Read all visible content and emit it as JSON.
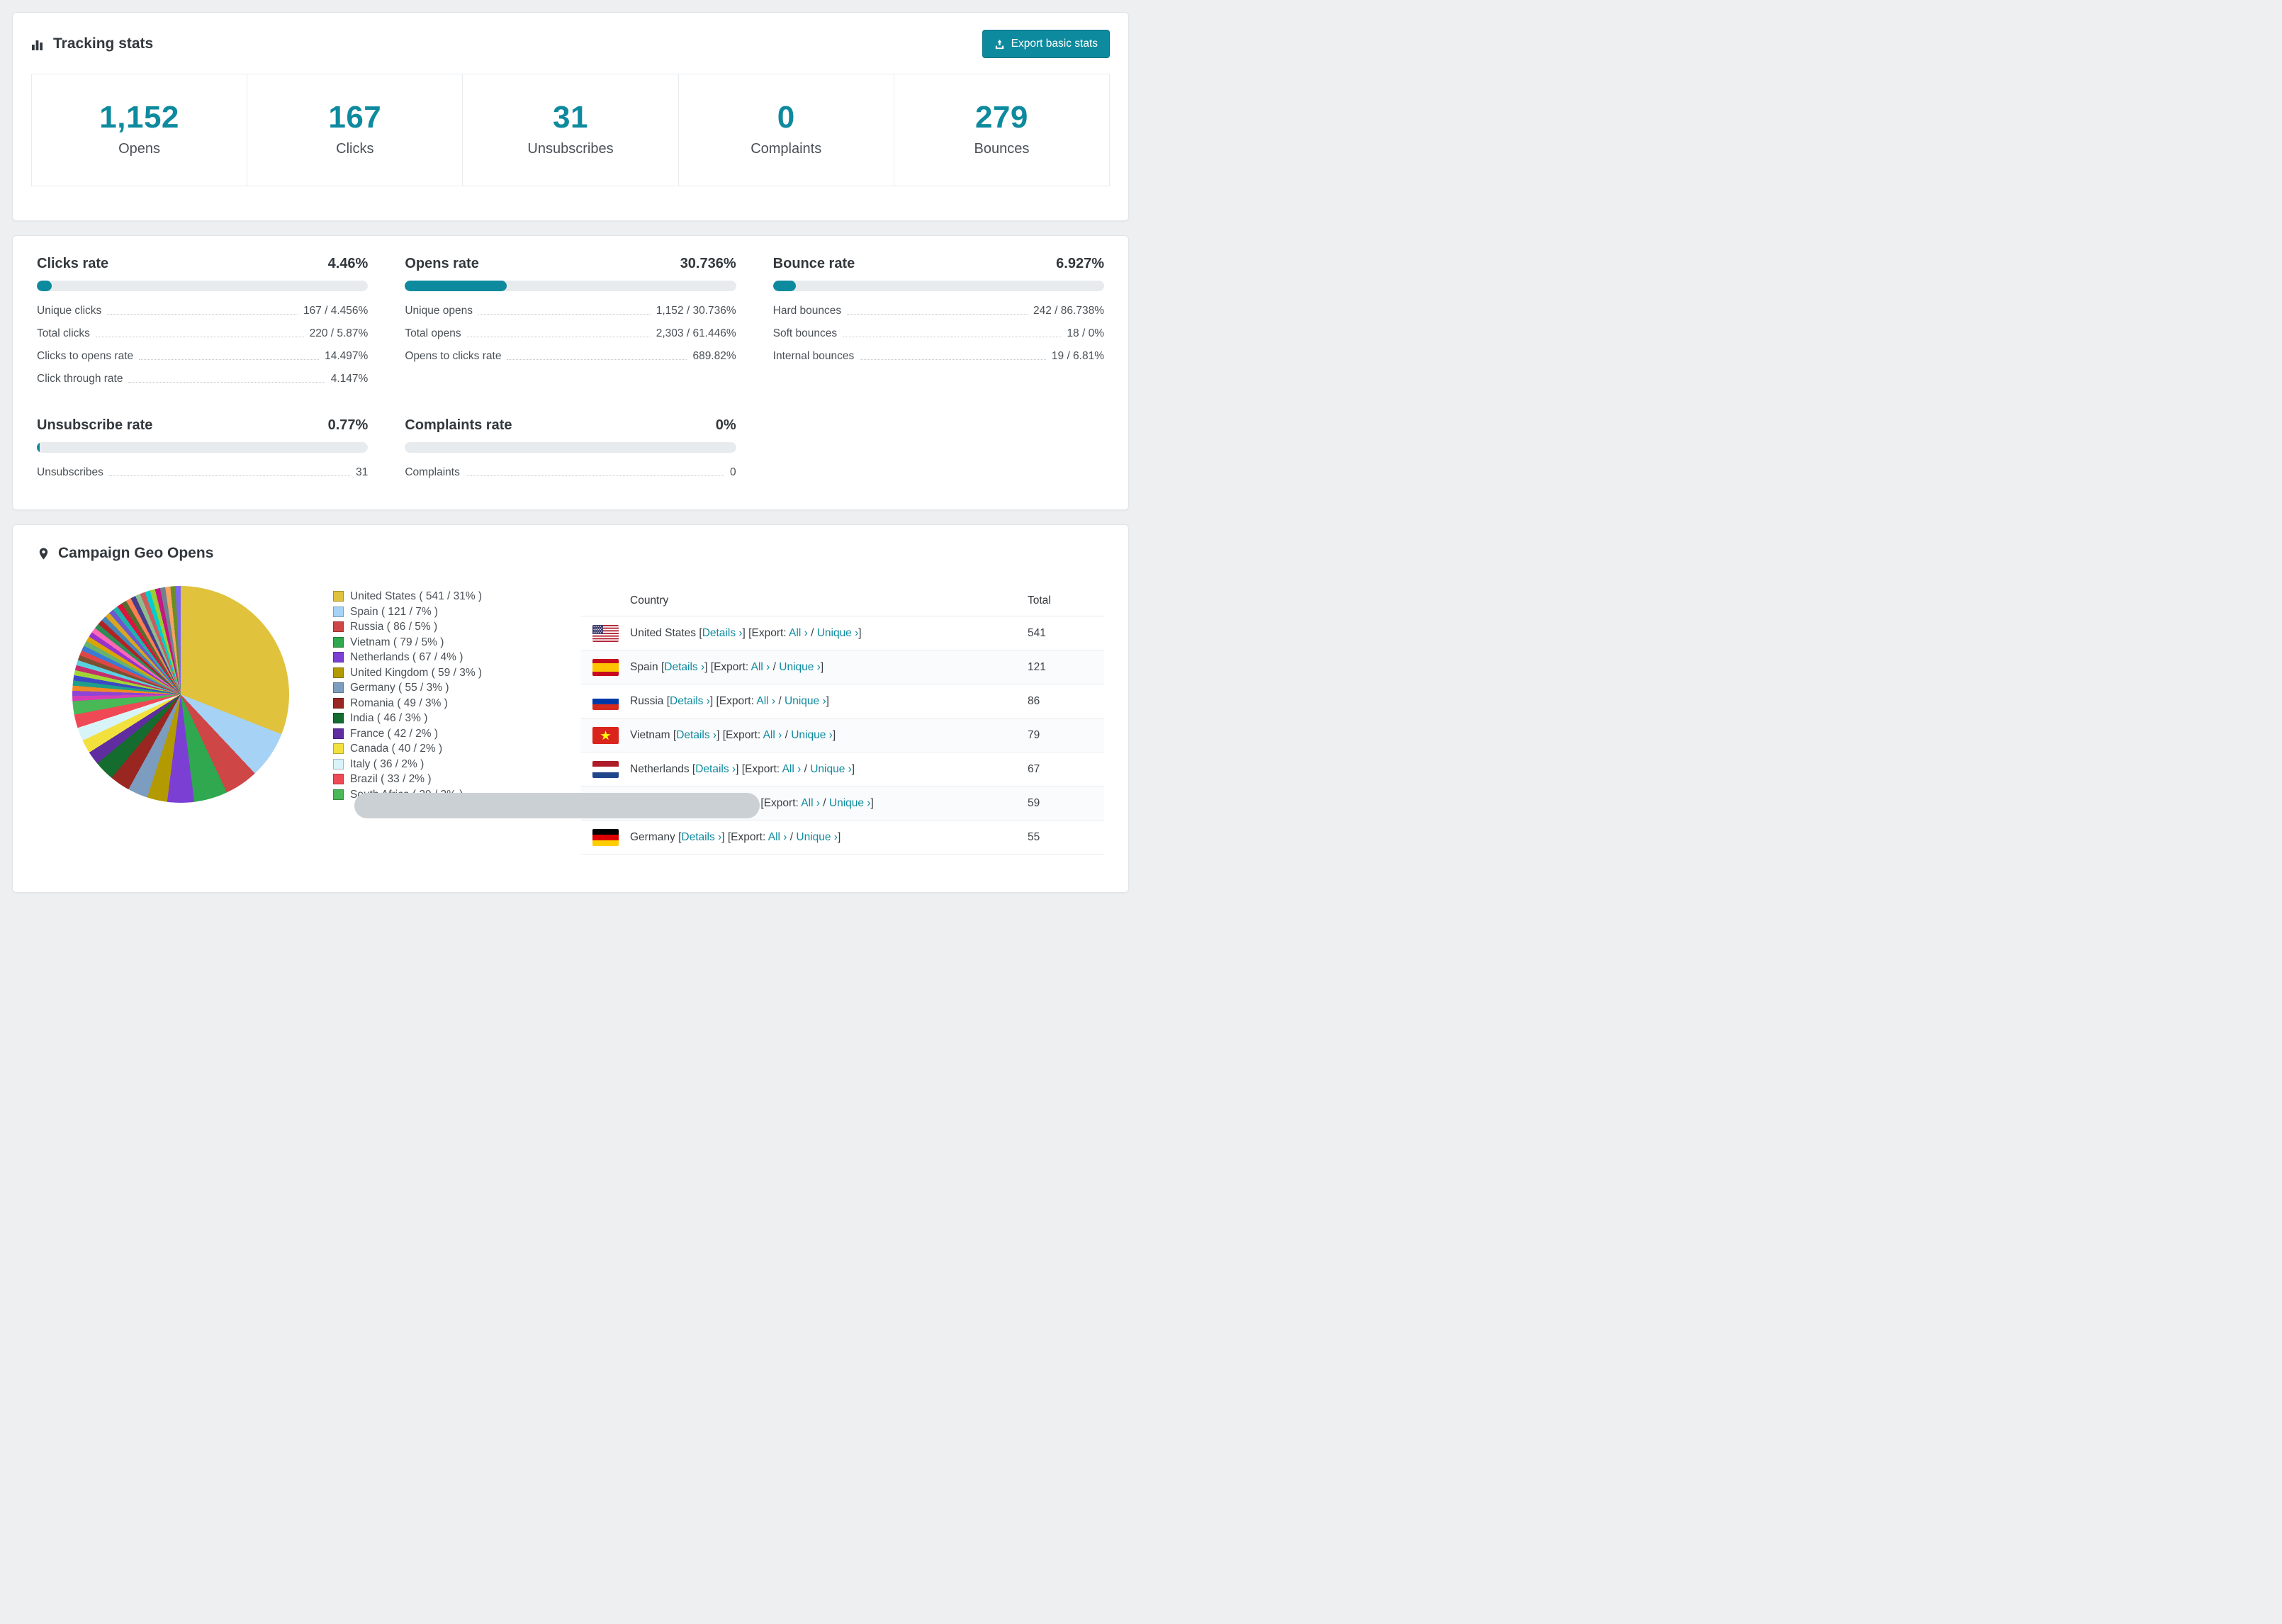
{
  "accent_color": "#0e8a9e",
  "icons": {
    "tracking_header": "bar-chart-icon",
    "export_button": "export-upload-icon",
    "geo_header": "map-pin-icon"
  },
  "tracking": {
    "title": "Tracking stats",
    "export_button": "Export basic stats",
    "stats": [
      {
        "value": "1,152",
        "label": "Opens"
      },
      {
        "value": "167",
        "label": "Clicks"
      },
      {
        "value": "31",
        "label": "Unsubscribes"
      },
      {
        "value": "0",
        "label": "Complaints"
      },
      {
        "value": "279",
        "label": "Bounces"
      }
    ]
  },
  "rates": [
    {
      "title": "Clicks rate",
      "value": "4.46%",
      "percent": 4.46,
      "rows": [
        {
          "label": "Unique clicks",
          "value": "167 / 4.456%"
        },
        {
          "label": "Total clicks",
          "value": "220 / 5.87%"
        },
        {
          "label": "Clicks to opens rate",
          "value": "14.497%"
        },
        {
          "label": "Click through rate",
          "value": "4.147%"
        }
      ]
    },
    {
      "title": "Opens rate",
      "value": "30.736%",
      "percent": 30.736,
      "rows": [
        {
          "label": "Unique opens",
          "value": "1,152 / 30.736%"
        },
        {
          "label": "Total opens",
          "value": "2,303 / 61.446%"
        },
        {
          "label": "Opens to clicks rate",
          "value": "689.82%"
        }
      ]
    },
    {
      "title": "Bounce rate",
      "value": "6.927%",
      "percent": 6.927,
      "rows": [
        {
          "label": "Hard bounces",
          "value": "242 / 86.738%"
        },
        {
          "label": "Soft bounces",
          "value": "18 / 0%"
        },
        {
          "label": "Internal bounces",
          "value": "19 / 6.81%"
        }
      ]
    },
    {
      "title": "Unsubscribe rate",
      "value": "0.77%",
      "percent": 0.77,
      "rows": [
        {
          "label": "Unsubscribes",
          "value": "31"
        }
      ]
    },
    {
      "title": "Complaints rate",
      "value": "0%",
      "percent": 0,
      "rows": [
        {
          "label": "Complaints",
          "value": "0"
        }
      ]
    }
  ],
  "chart_data": {
    "type": "pie",
    "title": "Campaign Geo Opens",
    "legend_position": "right",
    "slices": [
      {
        "label": "United States",
        "count": 541,
        "percent": 31,
        "color": "#e0c23d"
      },
      {
        "label": "Spain",
        "count": 121,
        "percent": 7,
        "color": "#a6d2f5"
      },
      {
        "label": "Russia",
        "count": 86,
        "percent": 5,
        "color": "#cf4647"
      },
      {
        "label": "Vietnam",
        "count": 79,
        "percent": 5,
        "color": "#2fa84f"
      },
      {
        "label": "Netherlands",
        "count": 67,
        "percent": 4,
        "color": "#7c3fd4"
      },
      {
        "label": "United Kingdom",
        "count": 59,
        "percent": 3,
        "color": "#b29a00"
      },
      {
        "label": "Germany",
        "count": 55,
        "percent": 3,
        "color": "#7c9cc0"
      },
      {
        "label": "Romania",
        "count": 49,
        "percent": 3,
        "color": "#992621"
      },
      {
        "label": "India",
        "count": 46,
        "percent": 3,
        "color": "#146c2e"
      },
      {
        "label": "France",
        "count": 42,
        "percent": 2,
        "color": "#5f2da0"
      },
      {
        "label": "Canada",
        "count": 40,
        "percent": 2,
        "color": "#f2e13d"
      },
      {
        "label": "Italy",
        "count": 36,
        "percent": 2,
        "color": "#d8f4f9"
      },
      {
        "label": "Brazil",
        "count": 33,
        "percent": 2,
        "color": "#ef4956"
      },
      {
        "label": "South Africa",
        "count": 29,
        "percent": 2,
        "color": "#49b857"
      }
    ],
    "others_colors": [
      "#d63db4",
      "#8f44d6",
      "#f08a24",
      "#1f9e89",
      "#3b49c4",
      "#a0d636",
      "#c42f6d",
      "#5ad0e0",
      "#7a5230",
      "#e04646",
      "#3a7bd5",
      "#67b26f",
      "#d9a404",
      "#9932cc",
      "#ff69b4",
      "#2e8b57",
      "#b22222",
      "#4682b4",
      "#daa520",
      "#6a5acd",
      "#20b2aa",
      "#dc143c",
      "#556b2f",
      "#ff7f50",
      "#483d8b",
      "#8fbc8f",
      "#cd5c5c",
      "#00ced1",
      "#9acd32",
      "#c71585",
      "#708090",
      "#f4a460",
      "#6b8e23",
      "#7b68ee"
    ]
  },
  "geo": {
    "title": "Campaign Geo Opens",
    "table": {
      "headers": {
        "country": "Country",
        "total": "Total"
      },
      "labels": {
        "open_bracket": "[",
        "close_bracket": "]",
        "details": "Details ›",
        "export": "Export:",
        "all": "All ›",
        "slash": "/",
        "unique": "Unique ›"
      },
      "rows": [
        {
          "flag": "us",
          "country": "United States",
          "total": "541"
        },
        {
          "flag": "es",
          "country": "Spain",
          "total": "121"
        },
        {
          "flag": "ru",
          "country": "Russia",
          "total": "86"
        },
        {
          "flag": "vn",
          "country": "Vietnam",
          "total": "79"
        },
        {
          "flag": "nl",
          "country": "Netherlands",
          "total": "67"
        },
        {
          "flag": "gb",
          "country": "United Kingdom",
          "total": "59"
        },
        {
          "flag": "de",
          "country": "Germany",
          "total": "55"
        }
      ]
    }
  }
}
